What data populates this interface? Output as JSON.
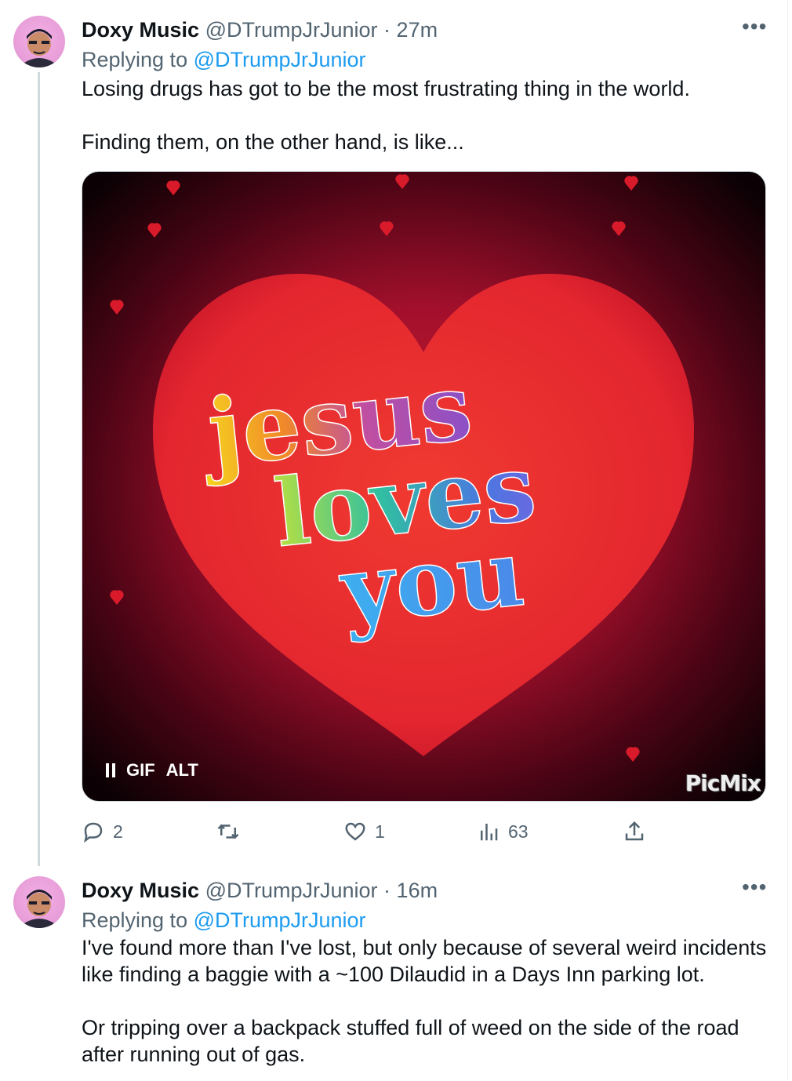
{
  "tweets": [
    {
      "name": "Doxy Music",
      "handle": "@DTrumpJrJunior",
      "dot": "·",
      "time": "27m",
      "replying_prefix": "Replying to ",
      "replying_to": "@DTrumpJrJunior",
      "text": "Losing drugs has got to be the most frustrating thing in the world.\n\nFinding them, on the other hand, is like...",
      "media": {
        "words": [
          "jesus",
          "loves",
          "you"
        ],
        "gif_label": "GIF",
        "alt_label": "ALT",
        "watermark": "PicMix"
      },
      "stats": {
        "replies": "2",
        "retweets": "",
        "likes": "1",
        "views": "63"
      }
    },
    {
      "name": "Doxy Music",
      "handle": "@DTrumpJrJunior",
      "dot": "·",
      "time": "16m",
      "replying_prefix": "Replying to ",
      "replying_to": "@DTrumpJrJunior",
      "text": "I've found more than I've lost, but only because of several weird incidents like finding a baggie with a ~100 Dilaudid in a Days Inn parking lot.\n\nOr tripping over a backpack stuffed full of weed on the side of the road after running out of gas."
    }
  ],
  "colors": {
    "link": "#1d9bf0",
    "secondary": "#536471",
    "heart": "#e3262f"
  },
  "icons": [
    "more-icon",
    "reply-icon",
    "retweet-icon",
    "like-icon",
    "views-icon",
    "share-icon",
    "pause-icon"
  ]
}
